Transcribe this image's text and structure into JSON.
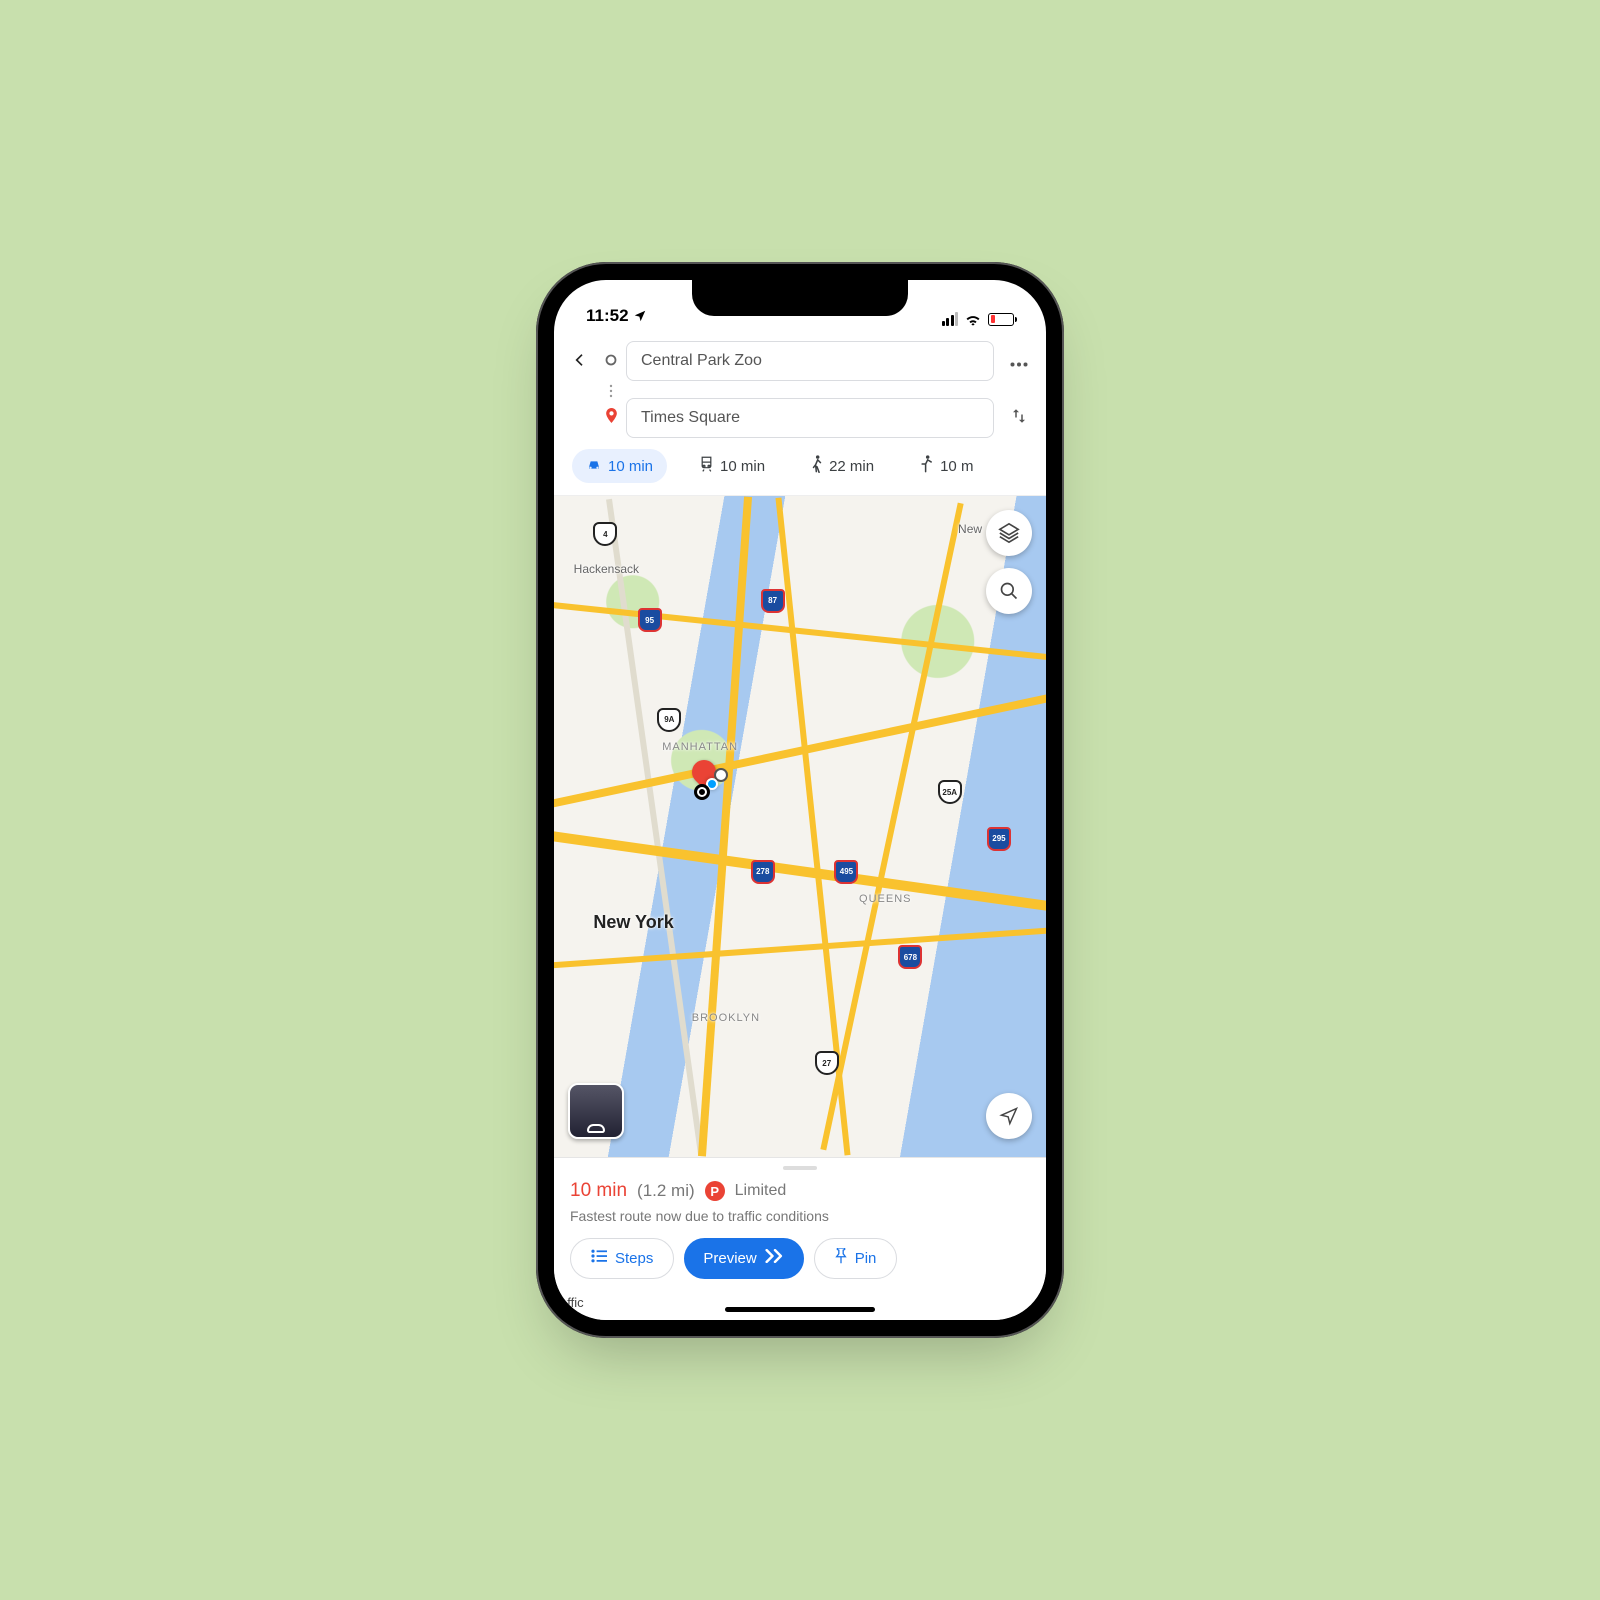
{
  "status": {
    "time": "11:52"
  },
  "directions": {
    "origin": "Central Park Zoo",
    "destination": "Times Square",
    "modes": [
      {
        "icon": "car",
        "label": "10 min",
        "active": true
      },
      {
        "icon": "transit",
        "label": "10 min",
        "active": false
      },
      {
        "icon": "walk",
        "label": "22 min",
        "active": false
      },
      {
        "icon": "ride",
        "label": "10 m",
        "active": false
      }
    ]
  },
  "map": {
    "labels": {
      "hackensack": "Hackensack",
      "manhattan": "MANHATTAN",
      "newyork": "New York",
      "brooklyn": "BROOKLYN",
      "queens": "QUEENS",
      "new_prefix": "New"
    },
    "shields": {
      "i95": "95",
      "i87": "87",
      "r9a": "9A",
      "r25a": "25A",
      "i295": "295",
      "i278": "278",
      "i495": "495",
      "i678": "678",
      "r4": "4",
      "r27": "27"
    }
  },
  "route": {
    "duration": "10 min",
    "distance": "(1.2 mi)",
    "parking_badge": "P",
    "parking_status": "Limited",
    "note": "Fastest route now due to traffic conditions"
  },
  "actions": {
    "steps": "Steps",
    "preview": "Preview",
    "pin": "Pin"
  },
  "footer": {
    "traffic": "affic"
  }
}
